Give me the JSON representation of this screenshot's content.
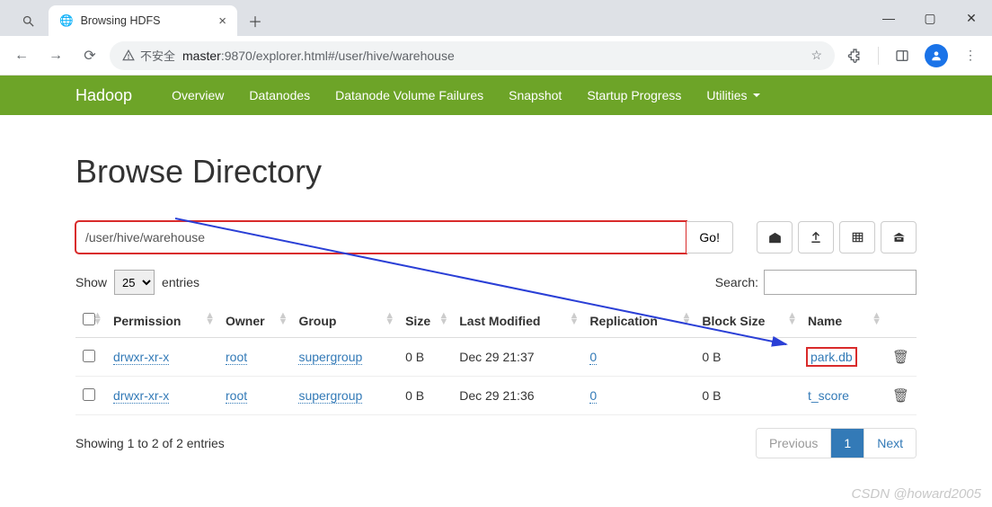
{
  "browser": {
    "tab_title": "Browsing HDFS",
    "url_insecure_label": "不安全",
    "url_host": "master",
    "url_rest": ":9870/explorer.html#/user/hive/warehouse"
  },
  "nav": {
    "brand": "Hadoop",
    "items": [
      "Overview",
      "Datanodes",
      "Datanode Volume Failures",
      "Snapshot",
      "Startup Progress",
      "Utilities"
    ]
  },
  "page": {
    "title": "Browse Directory",
    "path_value": "/user/hive/warehouse",
    "go_label": "Go!",
    "show_label": "Show",
    "entries_label": "entries",
    "entries_value": "25",
    "search_label": "Search:",
    "columns": {
      "permission": "Permission",
      "owner": "Owner",
      "group": "Group",
      "size": "Size",
      "last_modified": "Last Modified",
      "replication": "Replication",
      "block_size": "Block Size",
      "name": "Name"
    },
    "rows": [
      {
        "permission": "drwxr-xr-x",
        "owner": "root",
        "group": "supergroup",
        "size": "0 B",
        "last_modified": "Dec 29 21:37",
        "replication": "0",
        "block_size": "0 B",
        "name": "park.db",
        "highlight": true
      },
      {
        "permission": "drwxr-xr-x",
        "owner": "root",
        "group": "supergroup",
        "size": "0 B",
        "last_modified": "Dec 29 21:36",
        "replication": "0",
        "block_size": "0 B",
        "name": "t_score",
        "highlight": false
      }
    ],
    "footer_info": "Showing 1 to 2 of 2 entries",
    "pager": {
      "previous": "Previous",
      "page": "1",
      "next": "Next"
    }
  },
  "watermark": "CSDN @howard2005"
}
